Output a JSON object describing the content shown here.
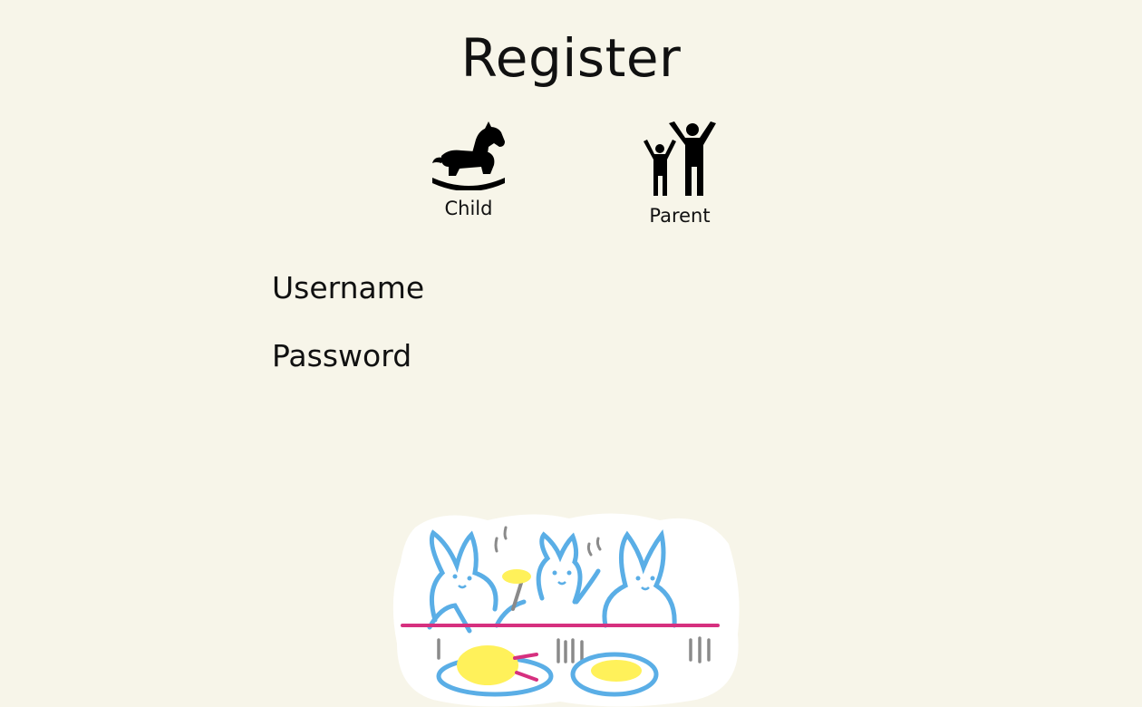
{
  "page": {
    "title": "Register"
  },
  "roles": [
    {
      "label": "Child",
      "icon": "rocking-horse-icon"
    },
    {
      "label": "Parent",
      "icon": "parent-child-icon"
    }
  ],
  "form": {
    "username_label": "Username",
    "username_value": "",
    "password_label": "Password",
    "password_value": ""
  },
  "illustration": {
    "name": "bunnies-dinner-sticker",
    "colors": {
      "outline": "#5aaee6",
      "table": "#d6307f",
      "food": "#fff15a",
      "cutlery": "#8a8a8a"
    }
  }
}
